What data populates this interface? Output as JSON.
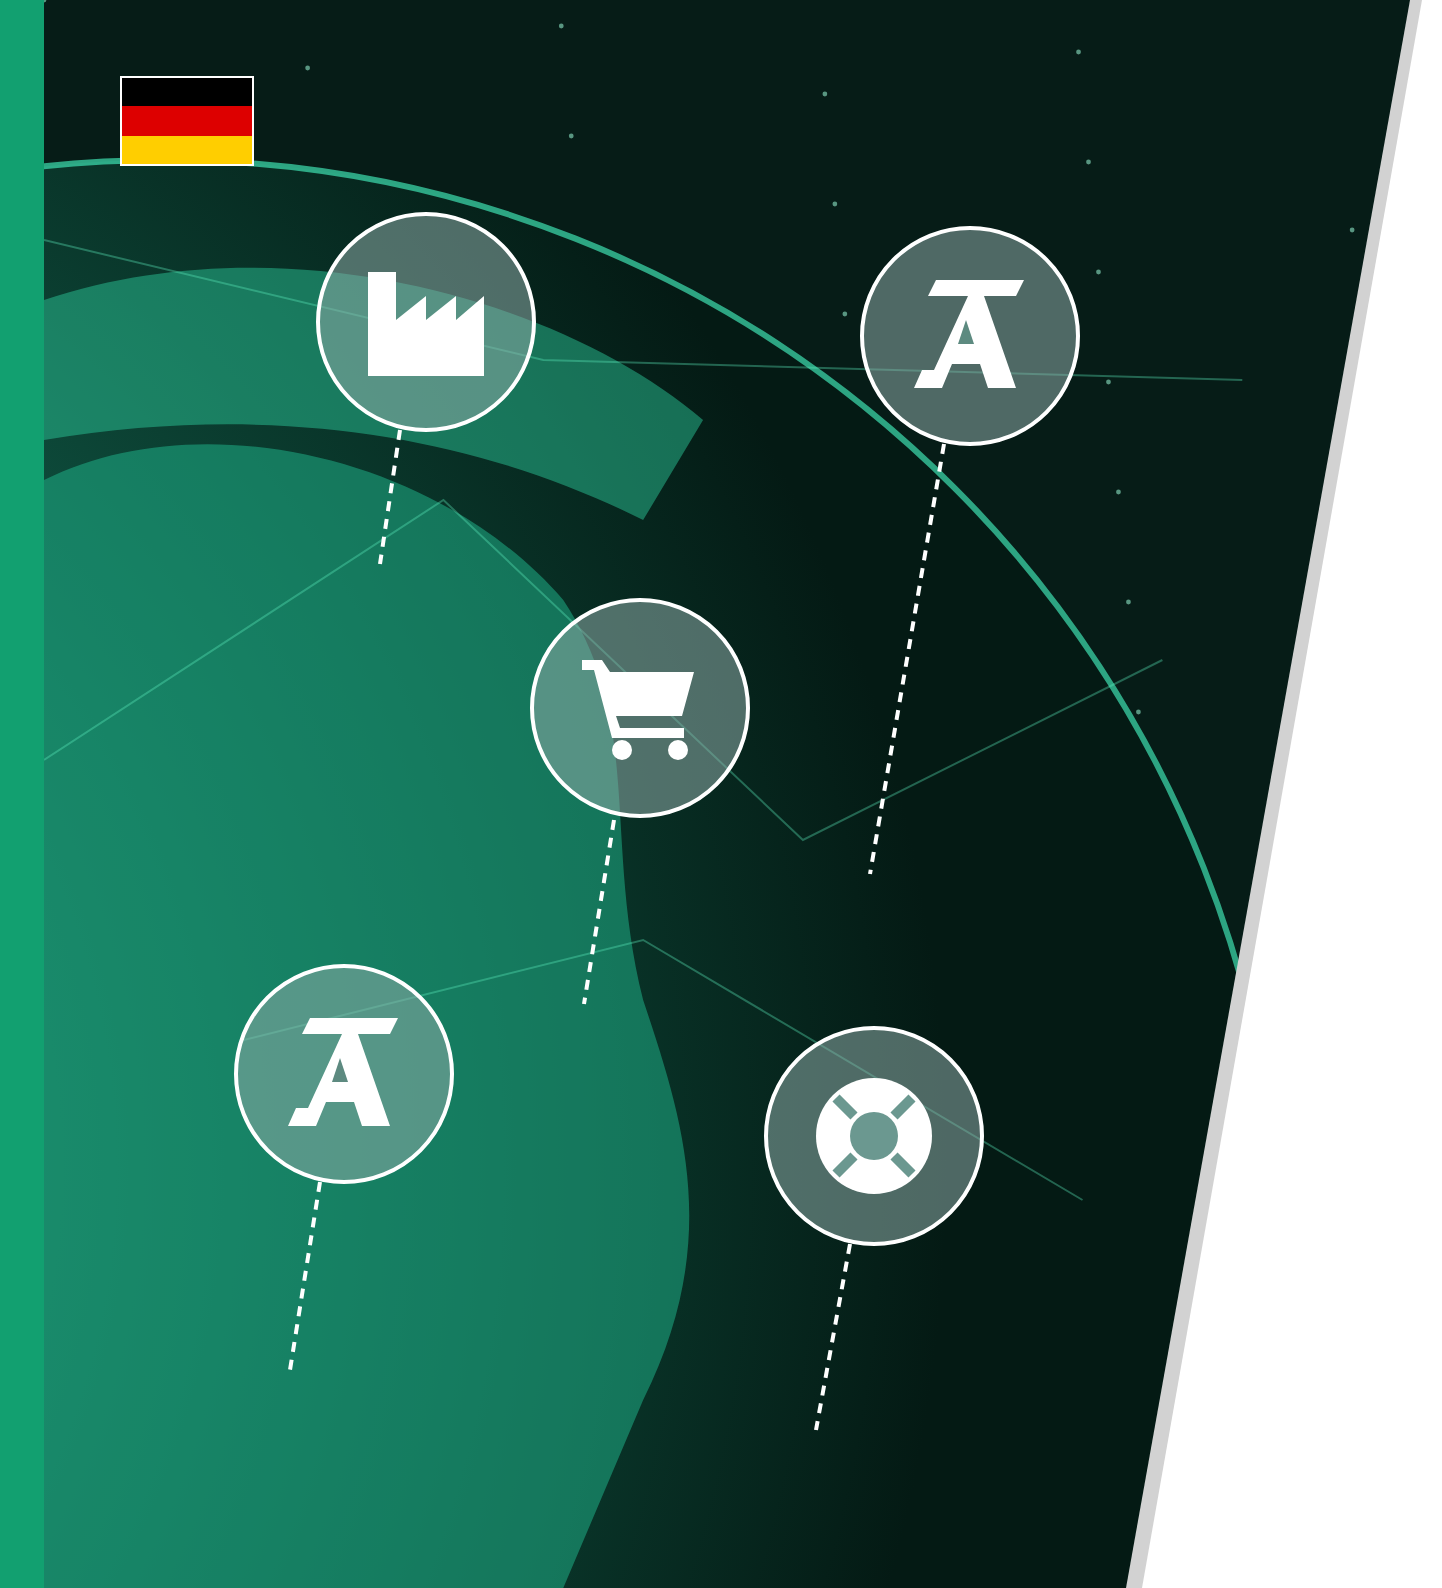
{
  "flag": {
    "kind": "germany"
  },
  "markers": [
    {
      "kind": "factory"
    },
    {
      "kind": "logo"
    },
    {
      "kind": "cart"
    },
    {
      "kind": "logo"
    },
    {
      "kind": "support"
    }
  ]
}
